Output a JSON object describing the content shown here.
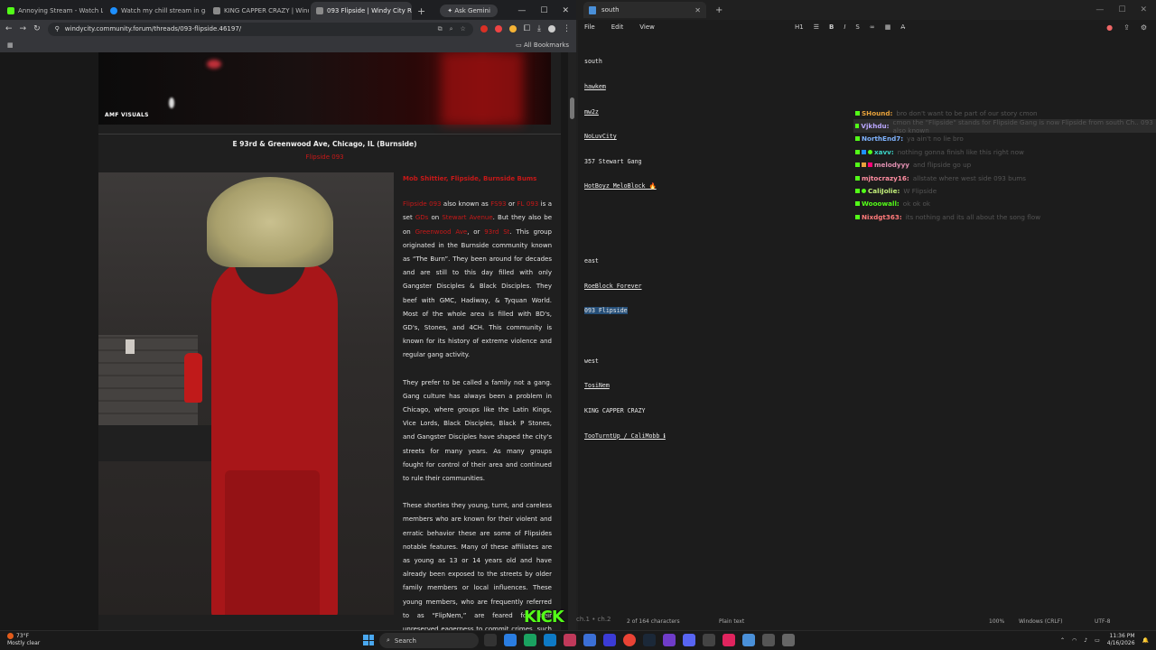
{
  "browser": {
    "tabs": [
      {
        "title": "Annoying Stream - Watch Li...",
        "color": "#53fc18"
      },
      {
        "title": "Watch my chill stream in gam...",
        "color": "#1e90ff"
      },
      {
        "title": "KING CAPPER CRAZY | Windy...",
        "color": "#8a8a8a"
      },
      {
        "title": "093 Flipside | Windy City Rele...",
        "color": "#8a8a8a",
        "active": true
      }
    ],
    "ask_gemini": "Ask Gemini",
    "url": "windycity.community.forum/threads/093-flipside.46197/",
    "all_bookmarks": "All Bookmarks"
  },
  "page": {
    "video_label": "AMF VISUALS",
    "address": "E 93rd & Greenwood Ave, Chicago, IL (Burnside)",
    "red_sub": "Flipside 093",
    "headline": "Mob Shittier, Flipside, Burnside Bums",
    "p1_parts": [
      "Flipside 093",
      " also known as ",
      "FS93",
      " or ",
      "FL 093",
      " is a set ",
      "GDs ",
      "on ",
      "Stewart Avenue",
      ". But they also be on ",
      "Greenwood Ave",
      ", or ",
      "93rd St",
      ". This group originated in the Burnside community known as “The Burn”. They been around for decades and are still to this day filled with only Gangster Disciples & Black Disciples. They beef with GMC, Hadiway, & Tyquan World. Most of the whole area is filled with BD's, GD's, Stones, and 4CH. This community is known for its history of extreme violence and regular gang activity."
    ],
    "p2": "They prefer to be called a family not a gang. Gang culture has always been a problem in Chicago, where groups like the Latin Kings, Vice Lords, Black Disciples, Black P Stones, and Gangster Disciples have shaped the city's streets for many years. As many groups fought for control of their area and continued to rule their communities.",
    "p3": "These shorties they young, turnt, and careless members who are known for their violent and erratic behavior these are some of Flipsides notable features. Many of these affiliates are as young as 13 or 14 years old and have already been exposed to the streets by older family members or local influences. These young members, who are frequently referred to as “FlipNem,” are feared for their unreserved eagerness to commit crimes, such as carjackings and armed robberies.",
    "red_color": "#c81818"
  },
  "notepad": {
    "tab_title": "south",
    "menu": [
      "File",
      "Edit",
      "View"
    ],
    "tools": [
      "H1",
      "☰",
      "B",
      "I",
      "S",
      "∞",
      "▦",
      "A̶"
    ],
    "lines_south": [
      "south",
      "hawkem",
      "mw2z",
      "NoLuvCity",
      "357 Stewart Gang",
      "HotBoyz MeloBlock 🔥"
    ],
    "lines_east": [
      "east",
      "RoeBlock Forever",
      "093 Flipside"
    ],
    "lines_west": [
      "west",
      "TosiNem",
      "KING CAPPER CRAZY",
      "TooTurntUp / CaliMobb ℹ"
    ],
    "status": {
      "chars": "2 of 164 characters",
      "format": "Plain text",
      "zoom": "100%",
      "eol": "Windows (CRLF)",
      "enc": "UTF-8"
    }
  },
  "chat": [
    {
      "name": "SHound:",
      "msg": "bro don't want to be part of our story cmon",
      "color": "#e8a23b"
    },
    {
      "name": "Vjkhdu:",
      "msg": "cmon the \"Flipside\" stands for Flipside Gang is now Flipside from south Ch.. 093 also known",
      "color": "#b9a6ff",
      "highlight": true
    },
    {
      "name": "NorthEnd7:",
      "msg": "ya ain't no lie bro",
      "color": "#7fb3ff"
    },
    {
      "name": "xavv:",
      "msg": "nothing gonna finish like this right now",
      "color": "#3bd3c6"
    },
    {
      "name": "melodyyy",
      "msg": "and flipside go up",
      "color": "#e08fb0"
    },
    {
      "name": "mjtocrazy16:",
      "msg": "allstate where west side 093 bums",
      "color": "#ff8da1"
    },
    {
      "name": "CaliJolie:",
      "msg": "W Flipside",
      "color": "#c3f07a"
    },
    {
      "name": "Wooowall:",
      "msg": "ok ok ok",
      "color": "#53fc18"
    },
    {
      "name": "Nixdgt363:",
      "msg": "its nothing and its all about the song flow",
      "color": "#ff7a7a"
    }
  ],
  "overlay": {
    "kick": "KICK",
    "kick_sub": "ch.1 • ch.2"
  },
  "taskbar": {
    "temp": "73°F",
    "weather": "Mostly clear",
    "search": "Search",
    "time": "11:36 PM",
    "date": "4/16/2026"
  }
}
